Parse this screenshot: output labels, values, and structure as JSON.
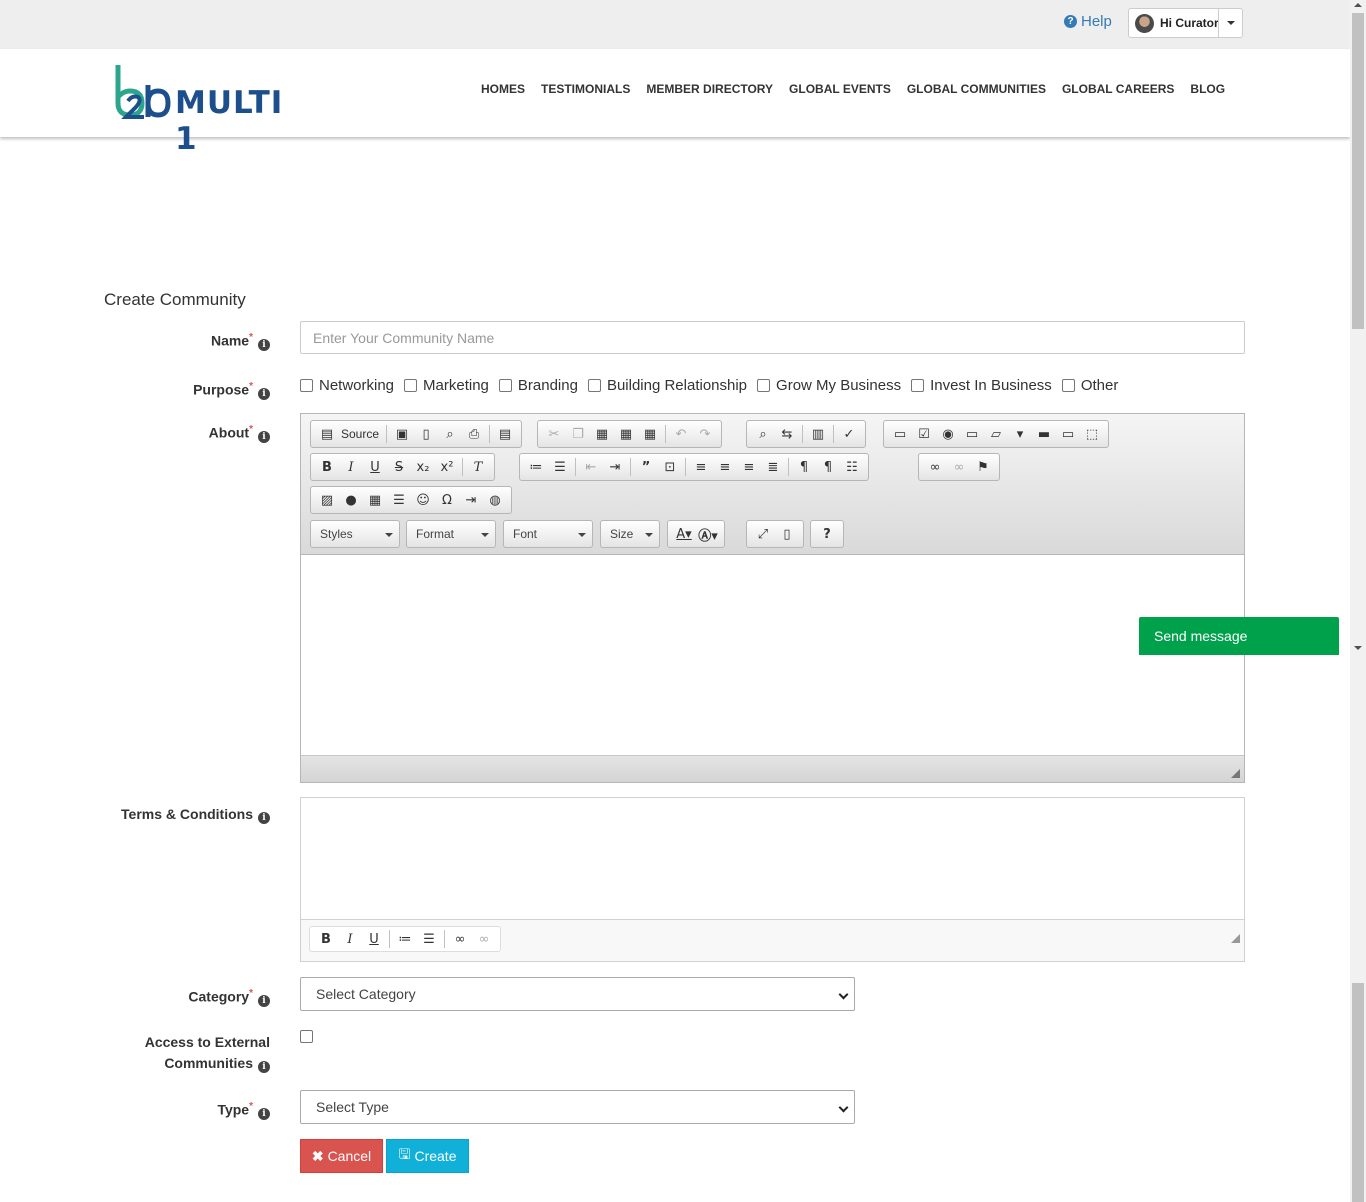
{
  "topbar": {
    "help_label": "Help",
    "user_label": "Hi Curator"
  },
  "brand": {
    "logo_text": "MULTI 1"
  },
  "nav": [
    "HOMES",
    "TESTIMONIALS",
    "MEMBER DIRECTORY",
    "GLOBAL EVENTS",
    "GLOBAL COMMUNITIES",
    "GLOBAL CAREERS",
    "BLOG"
  ],
  "form": {
    "title": "Create Community",
    "name": {
      "label": "Name",
      "placeholder": "Enter Your Community Name",
      "value": ""
    },
    "purpose": {
      "label": "Purpose",
      "options": [
        "Networking",
        "Marketing",
        "Branding",
        "Building Relationship",
        "Grow My Business",
        "Invest In Business",
        "Other"
      ]
    },
    "about": {
      "label": "About",
      "source_label": "Source",
      "styles_label": "Styles",
      "format_label": "Format",
      "font_label": "Font",
      "size_label": "Size"
    },
    "terms": {
      "label": "Terms & Conditions"
    },
    "category": {
      "label": "Category",
      "selected": "Select Category"
    },
    "access": {
      "label_line1": "Access to External",
      "label_line2": "Communities"
    },
    "type": {
      "label": "Type",
      "selected": "Select Type"
    },
    "cancel_label": "Cancel",
    "create_label": "Create"
  },
  "widget": {
    "send_message_label": "Send message"
  },
  "colors": {
    "primary": "#337ab7",
    "brand_blue": "#1d4f8c",
    "brand_green": "#2ca58d",
    "cancel": "#d9534f",
    "create": "#10b0d8",
    "send_message": "#00a14b"
  }
}
